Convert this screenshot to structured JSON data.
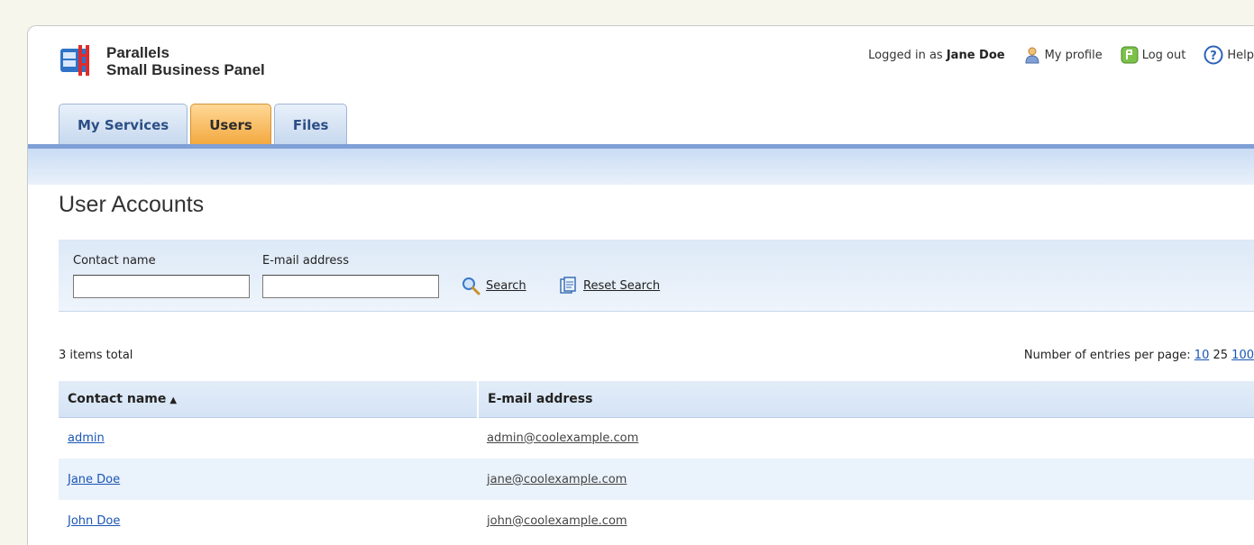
{
  "header": {
    "brand_line1": "Parallels",
    "brand_line2": "Small Business Panel",
    "logged_prefix": "Logged in as",
    "user_name": "Jane Doe",
    "my_profile": "My profile",
    "log_out": "Log out",
    "help": "Help"
  },
  "tabs": [
    {
      "label": "My Services",
      "active": false
    },
    {
      "label": "Users",
      "active": true
    },
    {
      "label": "Files",
      "active": false
    }
  ],
  "page": {
    "title": "User Accounts"
  },
  "search": {
    "contact_label": "Contact name",
    "contact_value": "",
    "email_label": "E-mail address",
    "email_value": "",
    "search_label": "Search",
    "reset_label": "Reset Search"
  },
  "list": {
    "total": "3 items total",
    "perpage_label": "Number of entries per page:",
    "perpage_options": [
      "10",
      "25",
      "100"
    ],
    "columns": {
      "name": "Contact name",
      "email": "E-mail address"
    },
    "sort_indicator": "▲",
    "rows": [
      {
        "name": "admin",
        "email": "admin@coolexample.com"
      },
      {
        "name": "Jane Doe",
        "email": "jane@coolexample.com"
      },
      {
        "name": "John Doe",
        "email": "john@coolexample.com"
      }
    ]
  },
  "colors": {
    "tab_active": "#f3a83e",
    "tab_inactive": "#c6d8ee",
    "link": "#1a55b5",
    "accent_line": "#7f9fd6"
  }
}
